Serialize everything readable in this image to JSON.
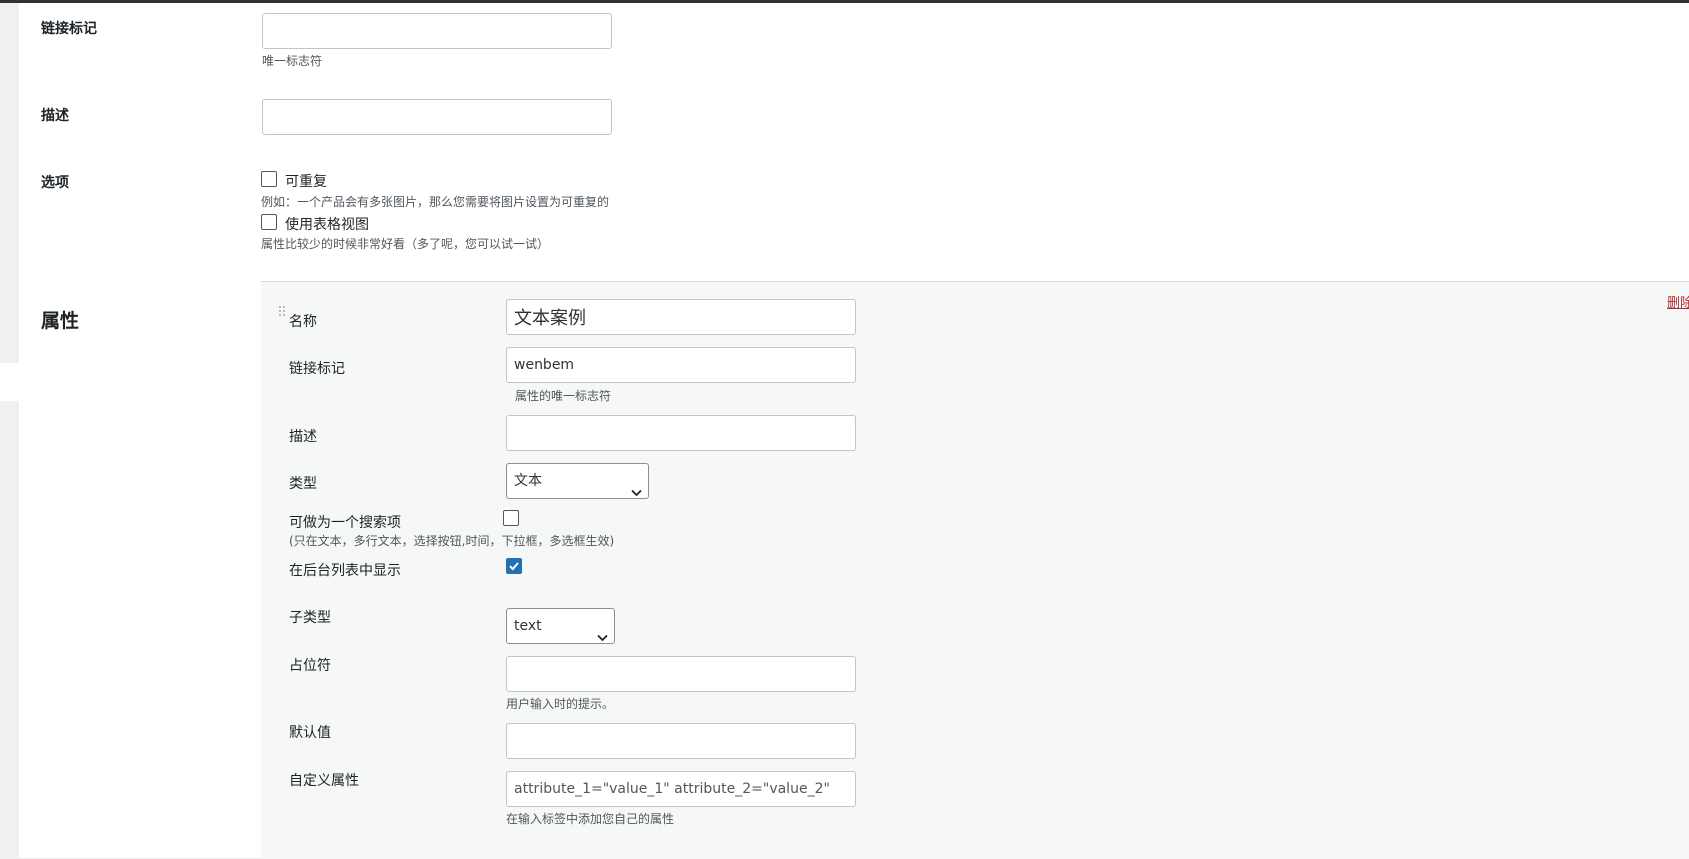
{
  "top": {
    "link_mark": {
      "label": "链接标记",
      "value": "",
      "hint": "唯一标志符"
    },
    "description": {
      "label": "描述",
      "value": ""
    },
    "options": {
      "label": "选项",
      "repeatable": {
        "label": "可重复",
        "checked": false,
        "hint": "例如：一个产品会有多张图片，那么您需要将图片设置为可重复的"
      },
      "table_view": {
        "label": "使用表格视图",
        "checked": false,
        "hint": "属性比较少的时候非常好看（多了呢，您可以试一试）"
      }
    }
  },
  "attributes": {
    "heading": "属性",
    "delete_label": "删除",
    "name": {
      "label": "名称",
      "value": "文本案例"
    },
    "link_mark": {
      "label": "链接标记",
      "value": "wenbem",
      "hint": "属性的唯一标志符"
    },
    "description": {
      "label": "描述",
      "value": ""
    },
    "type": {
      "label": "类型",
      "selected": "文本"
    },
    "searchable": {
      "label": "可做为一个搜索项",
      "hint": "(只在文本，多行文本，选择按钮,时间，下拉框，多选框生效)",
      "checked": false
    },
    "show_in_list": {
      "label": "在后台列表中显示",
      "checked": true
    },
    "subtype": {
      "label": "子类型",
      "selected": "text"
    },
    "placeholder": {
      "label": "占位符",
      "value": "",
      "hint": "用户输入时的提示。"
    },
    "default_value": {
      "label": "默认值",
      "value": ""
    },
    "custom_attr": {
      "label": "自定义属性",
      "value": "",
      "placeholder": "attribute_1=\"value_1\" attribute_2=\"value_2\"",
      "hint": "在输入标签中添加您自己的属性"
    }
  },
  "colors": {
    "accent": "#2271b1",
    "danger": "#b32d2e",
    "topbar": "#2c3338"
  }
}
